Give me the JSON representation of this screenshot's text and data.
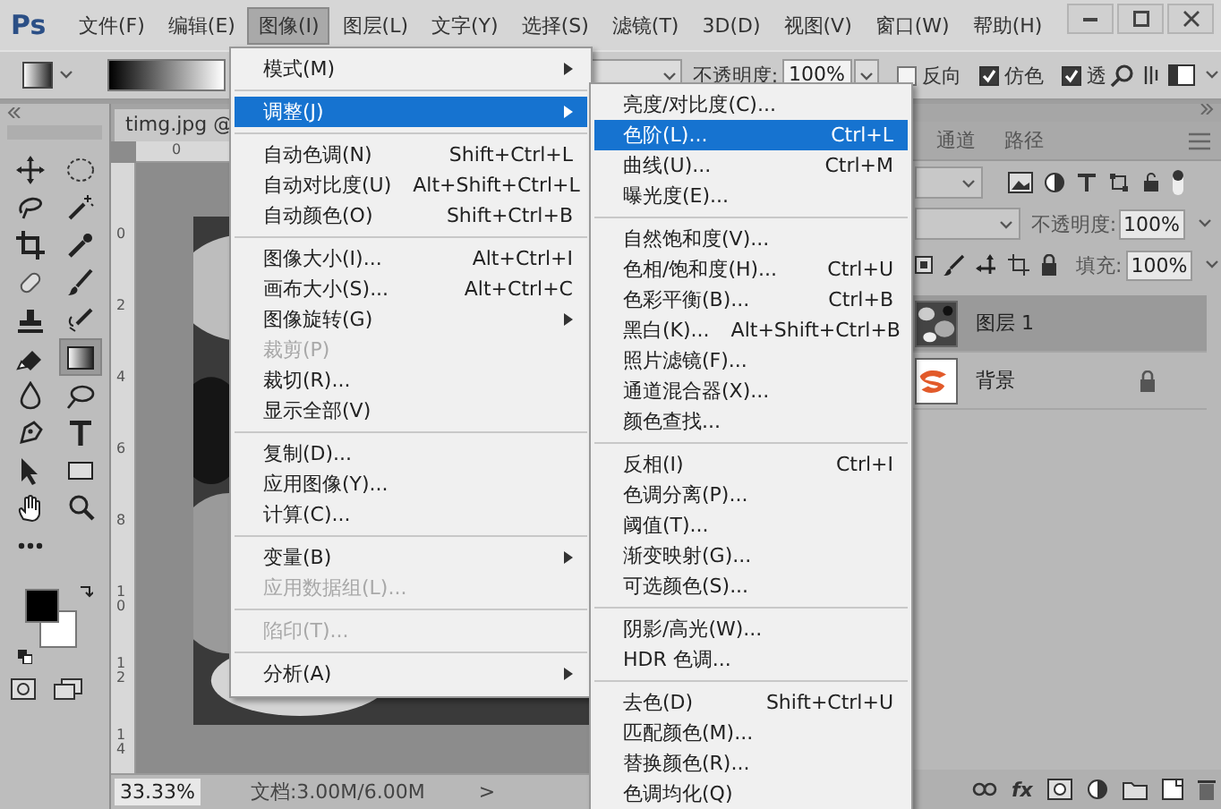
{
  "app": {
    "logo": "Ps"
  },
  "menubar": [
    {
      "label": "文件(F)",
      "selected": false
    },
    {
      "label": "编辑(E)",
      "selected": false
    },
    {
      "label": "图像(I)",
      "selected": true
    },
    {
      "label": "图层(L)",
      "selected": false
    },
    {
      "label": "文字(Y)",
      "selected": false
    },
    {
      "label": "选择(S)",
      "selected": false
    },
    {
      "label": "滤镜(T)",
      "selected": false
    },
    {
      "label": "3D(D)",
      "selected": false
    },
    {
      "label": "视图(V)",
      "selected": false
    },
    {
      "label": "窗口(W)",
      "selected": false
    },
    {
      "label": "帮助(H)",
      "selected": false
    }
  ],
  "options_bar": {
    "opacity_label": "不透明度:",
    "opacity_value": "100%",
    "checkboxes": [
      {
        "label": "反向",
        "checked": false
      },
      {
        "label": "仿色",
        "checked": true
      },
      {
        "label": "透",
        "checked": true
      }
    ]
  },
  "toolbox": {
    "tools": [
      {
        "kind": "move",
        "selected": false
      },
      {
        "kind": "marquee",
        "selected": false
      },
      {
        "kind": "lasso",
        "selected": false
      },
      {
        "kind": "wand",
        "selected": false
      },
      {
        "kind": "crop",
        "selected": false
      },
      {
        "kind": "eyedropper",
        "selected": false
      },
      {
        "kind": "bandage",
        "selected": false
      },
      {
        "kind": "brush",
        "selected": false
      },
      {
        "kind": "stamp",
        "selected": false
      },
      {
        "kind": "history",
        "selected": false
      },
      {
        "kind": "eraser",
        "selected": false
      },
      {
        "kind": "gradient",
        "selected": true
      },
      {
        "kind": "drop",
        "selected": false
      },
      {
        "kind": "dodge",
        "selected": false
      },
      {
        "kind": "pen",
        "selected": false
      },
      {
        "kind": "type",
        "selected": false
      },
      {
        "kind": "arrow",
        "selected": false
      },
      {
        "kind": "rectangle",
        "selected": false
      },
      {
        "kind": "hand",
        "selected": false
      },
      {
        "kind": "zoom",
        "selected": false
      },
      {
        "kind": "more",
        "selected": false
      }
    ]
  },
  "document": {
    "tab": "timg.jpg @",
    "h_ruler": [
      "0"
    ],
    "v_ruler": [
      "0",
      "2",
      "4",
      "6",
      "8",
      "10",
      "12",
      "14"
    ],
    "zoom": "33.33%",
    "info": "文档:3.00M/6.00M",
    "arrow": ">"
  },
  "image_menu": {
    "items": [
      {
        "kind": "item",
        "label": "模式(M)",
        "submenu": true,
        "selected": false,
        "disabled": false
      },
      {
        "kind": "separator"
      },
      {
        "kind": "item",
        "label": "调整(J)",
        "submenu": true,
        "selected": true,
        "disabled": false
      },
      {
        "kind": "separator"
      },
      {
        "kind": "item",
        "label": "自动色调(N)",
        "shortcut": "Shift+Ctrl+L",
        "submenu": false,
        "selected": false,
        "disabled": false
      },
      {
        "kind": "item",
        "label": "自动对比度(U)",
        "shortcut": "Alt+Shift+Ctrl+L",
        "submenu": false,
        "selected": false,
        "disabled": false
      },
      {
        "kind": "item",
        "label": "自动颜色(O)",
        "shortcut": "Shift+Ctrl+B",
        "submenu": false,
        "selected": false,
        "disabled": false
      },
      {
        "kind": "separator"
      },
      {
        "kind": "item",
        "label": "图像大小(I)...",
        "shortcut": "Alt+Ctrl+I",
        "submenu": false,
        "selected": false,
        "disabled": false
      },
      {
        "kind": "item",
        "label": "画布大小(S)...",
        "shortcut": "Alt+Ctrl+C",
        "submenu": false,
        "selected": false,
        "disabled": false
      },
      {
        "kind": "item",
        "label": "图像旋转(G)",
        "submenu": true,
        "selected": false,
        "disabled": false
      },
      {
        "kind": "item",
        "label": "裁剪(P)",
        "submenu": false,
        "selected": false,
        "disabled": true
      },
      {
        "kind": "item",
        "label": "裁切(R)...",
        "submenu": false,
        "selected": false,
        "disabled": false
      },
      {
        "kind": "item",
        "label": "显示全部(V)",
        "submenu": false,
        "selected": false,
        "disabled": false
      },
      {
        "kind": "separator"
      },
      {
        "kind": "item",
        "label": "复制(D)...",
        "submenu": false,
        "selected": false,
        "disabled": false
      },
      {
        "kind": "item",
        "label": "应用图像(Y)...",
        "submenu": false,
        "selected": false,
        "disabled": false
      },
      {
        "kind": "item",
        "label": "计算(C)...",
        "submenu": false,
        "selected": false,
        "disabled": false
      },
      {
        "kind": "separator"
      },
      {
        "kind": "item",
        "label": "变量(B)",
        "submenu": true,
        "selected": false,
        "disabled": false
      },
      {
        "kind": "item",
        "label": "应用数据组(L)...",
        "submenu": false,
        "selected": false,
        "disabled": true
      },
      {
        "kind": "separator"
      },
      {
        "kind": "item",
        "label": "陷印(T)...",
        "submenu": false,
        "selected": false,
        "disabled": true
      },
      {
        "kind": "separator"
      },
      {
        "kind": "item",
        "label": "分析(A)",
        "submenu": true,
        "selected": false,
        "disabled": false
      }
    ]
  },
  "adjust_menu": {
    "items": [
      {
        "kind": "item",
        "label": "亮度/对比度(C)...",
        "submenu": false,
        "selected": false,
        "disabled": false
      },
      {
        "kind": "item",
        "label": "色阶(L)...",
        "shortcut": "Ctrl+L",
        "submenu": false,
        "selected": true,
        "disabled": false
      },
      {
        "kind": "item",
        "label": "曲线(U)...",
        "shortcut": "Ctrl+M",
        "submenu": false,
        "selected": false,
        "disabled": false
      },
      {
        "kind": "item",
        "label": "曝光度(E)...",
        "submenu": false,
        "selected": false,
        "disabled": false
      },
      {
        "kind": "separator"
      },
      {
        "kind": "item",
        "label": "自然饱和度(V)...",
        "submenu": false,
        "selected": false,
        "disabled": false
      },
      {
        "kind": "item",
        "label": "色相/饱和度(H)...",
        "shortcut": "Ctrl+U",
        "submenu": false,
        "selected": false,
        "disabled": false
      },
      {
        "kind": "item",
        "label": "色彩平衡(B)...",
        "shortcut": "Ctrl+B",
        "submenu": false,
        "selected": false,
        "disabled": false
      },
      {
        "kind": "item",
        "label": "黑白(K)...",
        "shortcut": "Alt+Shift+Ctrl+B",
        "submenu": false,
        "selected": false,
        "disabled": false
      },
      {
        "kind": "item",
        "label": "照片滤镜(F)...",
        "submenu": false,
        "selected": false,
        "disabled": false
      },
      {
        "kind": "item",
        "label": "通道混合器(X)...",
        "submenu": false,
        "selected": false,
        "disabled": false
      },
      {
        "kind": "item",
        "label": "颜色查找...",
        "submenu": false,
        "selected": false,
        "disabled": false
      },
      {
        "kind": "separator"
      },
      {
        "kind": "item",
        "label": "反相(I)",
        "shortcut": "Ctrl+I",
        "submenu": false,
        "selected": false,
        "disabled": false
      },
      {
        "kind": "item",
        "label": "色调分离(P)...",
        "submenu": false,
        "selected": false,
        "disabled": false
      },
      {
        "kind": "item",
        "label": "阈值(T)...",
        "submenu": false,
        "selected": false,
        "disabled": false
      },
      {
        "kind": "item",
        "label": "渐变映射(G)...",
        "submenu": false,
        "selected": false,
        "disabled": false
      },
      {
        "kind": "item",
        "label": "可选颜色(S)...",
        "submenu": false,
        "selected": false,
        "disabled": false
      },
      {
        "kind": "separator"
      },
      {
        "kind": "item",
        "label": "阴影/高光(W)...",
        "submenu": false,
        "selected": false,
        "disabled": false
      },
      {
        "kind": "item",
        "label": "HDR 色调...",
        "submenu": false,
        "selected": false,
        "disabled": false
      },
      {
        "kind": "separator"
      },
      {
        "kind": "item",
        "label": "去色(D)",
        "shortcut": "Shift+Ctrl+U",
        "submenu": false,
        "selected": false,
        "disabled": false
      },
      {
        "kind": "item",
        "label": "匹配颜色(M)...",
        "submenu": false,
        "selected": false,
        "disabled": false
      },
      {
        "kind": "item",
        "label": "替换颜色(R)...",
        "submenu": false,
        "selected": false,
        "disabled": false
      },
      {
        "kind": "item",
        "label": "色调均化(Q)",
        "submenu": false,
        "selected": false,
        "disabled": false
      }
    ]
  },
  "layers_panel": {
    "tabs": [
      {
        "label": "通道",
        "selected": false
      },
      {
        "label": "路径",
        "selected": false
      }
    ],
    "opacity_label": "不透明度:",
    "opacity_value": "100%",
    "fill_label": "填充:",
    "fill_value": "100%",
    "layers": [
      {
        "name": "图层 1",
        "selected": true,
        "locked": false,
        "kind": "texture"
      },
      {
        "name": "背景",
        "selected": false,
        "locked": true,
        "kind": "swoosh"
      }
    ],
    "fx": "fx"
  }
}
